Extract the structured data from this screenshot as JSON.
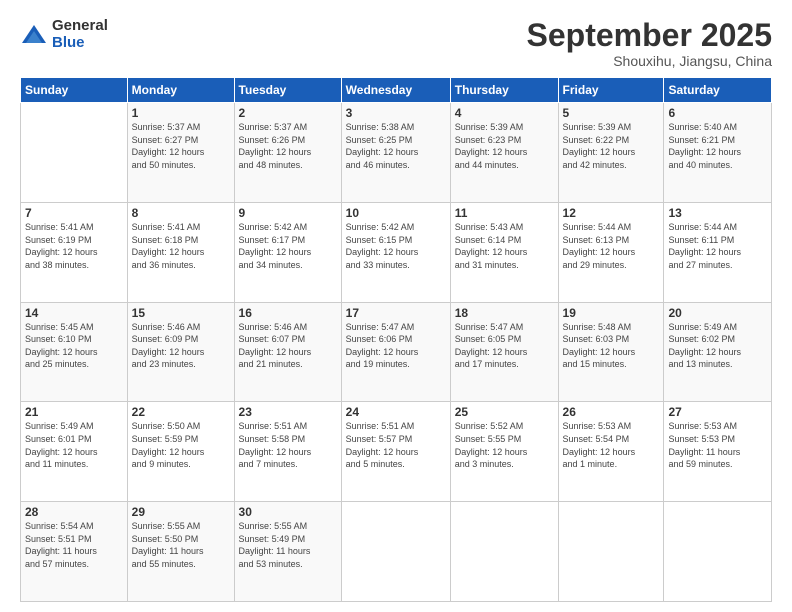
{
  "logo": {
    "general": "General",
    "blue": "Blue"
  },
  "calendar": {
    "title": "September 2025",
    "subtitle": "Shouxihu, Jiangsu, China"
  },
  "headers": [
    "Sunday",
    "Monday",
    "Tuesday",
    "Wednesday",
    "Thursday",
    "Friday",
    "Saturday"
  ],
  "weeks": [
    [
      {
        "day": "",
        "info": ""
      },
      {
        "day": "1",
        "info": "Sunrise: 5:37 AM\nSunset: 6:27 PM\nDaylight: 12 hours\nand 50 minutes."
      },
      {
        "day": "2",
        "info": "Sunrise: 5:37 AM\nSunset: 6:26 PM\nDaylight: 12 hours\nand 48 minutes."
      },
      {
        "day": "3",
        "info": "Sunrise: 5:38 AM\nSunset: 6:25 PM\nDaylight: 12 hours\nand 46 minutes."
      },
      {
        "day": "4",
        "info": "Sunrise: 5:39 AM\nSunset: 6:23 PM\nDaylight: 12 hours\nand 44 minutes."
      },
      {
        "day": "5",
        "info": "Sunrise: 5:39 AM\nSunset: 6:22 PM\nDaylight: 12 hours\nand 42 minutes."
      },
      {
        "day": "6",
        "info": "Sunrise: 5:40 AM\nSunset: 6:21 PM\nDaylight: 12 hours\nand 40 minutes."
      }
    ],
    [
      {
        "day": "7",
        "info": "Sunrise: 5:41 AM\nSunset: 6:19 PM\nDaylight: 12 hours\nand 38 minutes."
      },
      {
        "day": "8",
        "info": "Sunrise: 5:41 AM\nSunset: 6:18 PM\nDaylight: 12 hours\nand 36 minutes."
      },
      {
        "day": "9",
        "info": "Sunrise: 5:42 AM\nSunset: 6:17 PM\nDaylight: 12 hours\nand 34 minutes."
      },
      {
        "day": "10",
        "info": "Sunrise: 5:42 AM\nSunset: 6:15 PM\nDaylight: 12 hours\nand 33 minutes."
      },
      {
        "day": "11",
        "info": "Sunrise: 5:43 AM\nSunset: 6:14 PM\nDaylight: 12 hours\nand 31 minutes."
      },
      {
        "day": "12",
        "info": "Sunrise: 5:44 AM\nSunset: 6:13 PM\nDaylight: 12 hours\nand 29 minutes."
      },
      {
        "day": "13",
        "info": "Sunrise: 5:44 AM\nSunset: 6:11 PM\nDaylight: 12 hours\nand 27 minutes."
      }
    ],
    [
      {
        "day": "14",
        "info": "Sunrise: 5:45 AM\nSunset: 6:10 PM\nDaylight: 12 hours\nand 25 minutes."
      },
      {
        "day": "15",
        "info": "Sunrise: 5:46 AM\nSunset: 6:09 PM\nDaylight: 12 hours\nand 23 minutes."
      },
      {
        "day": "16",
        "info": "Sunrise: 5:46 AM\nSunset: 6:07 PM\nDaylight: 12 hours\nand 21 minutes."
      },
      {
        "day": "17",
        "info": "Sunrise: 5:47 AM\nSunset: 6:06 PM\nDaylight: 12 hours\nand 19 minutes."
      },
      {
        "day": "18",
        "info": "Sunrise: 5:47 AM\nSunset: 6:05 PM\nDaylight: 12 hours\nand 17 minutes."
      },
      {
        "day": "19",
        "info": "Sunrise: 5:48 AM\nSunset: 6:03 PM\nDaylight: 12 hours\nand 15 minutes."
      },
      {
        "day": "20",
        "info": "Sunrise: 5:49 AM\nSunset: 6:02 PM\nDaylight: 12 hours\nand 13 minutes."
      }
    ],
    [
      {
        "day": "21",
        "info": "Sunrise: 5:49 AM\nSunset: 6:01 PM\nDaylight: 12 hours\nand 11 minutes."
      },
      {
        "day": "22",
        "info": "Sunrise: 5:50 AM\nSunset: 5:59 PM\nDaylight: 12 hours\nand 9 minutes."
      },
      {
        "day": "23",
        "info": "Sunrise: 5:51 AM\nSunset: 5:58 PM\nDaylight: 12 hours\nand 7 minutes."
      },
      {
        "day": "24",
        "info": "Sunrise: 5:51 AM\nSunset: 5:57 PM\nDaylight: 12 hours\nand 5 minutes."
      },
      {
        "day": "25",
        "info": "Sunrise: 5:52 AM\nSunset: 5:55 PM\nDaylight: 12 hours\nand 3 minutes."
      },
      {
        "day": "26",
        "info": "Sunrise: 5:53 AM\nSunset: 5:54 PM\nDaylight: 12 hours\nand 1 minute."
      },
      {
        "day": "27",
        "info": "Sunrise: 5:53 AM\nSunset: 5:53 PM\nDaylight: 11 hours\nand 59 minutes."
      }
    ],
    [
      {
        "day": "28",
        "info": "Sunrise: 5:54 AM\nSunset: 5:51 PM\nDaylight: 11 hours\nand 57 minutes."
      },
      {
        "day": "29",
        "info": "Sunrise: 5:55 AM\nSunset: 5:50 PM\nDaylight: 11 hours\nand 55 minutes."
      },
      {
        "day": "30",
        "info": "Sunrise: 5:55 AM\nSunset: 5:49 PM\nDaylight: 11 hours\nand 53 minutes."
      },
      {
        "day": "",
        "info": ""
      },
      {
        "day": "",
        "info": ""
      },
      {
        "day": "",
        "info": ""
      },
      {
        "day": "",
        "info": ""
      }
    ]
  ]
}
